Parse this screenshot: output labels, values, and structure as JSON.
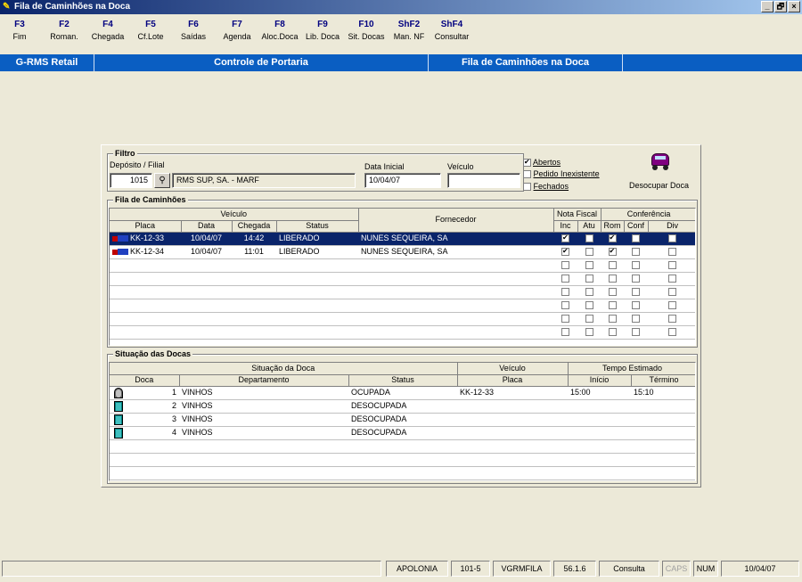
{
  "window": {
    "title": "Fila de Caminhões na Doca",
    "buttons": [
      "_",
      "🗗",
      "×"
    ]
  },
  "fkeys": [
    {
      "key": "F3",
      "label": "Fim"
    },
    {
      "key": "F2",
      "label": "Roman."
    },
    {
      "key": "F4",
      "label": "Chegada"
    },
    {
      "key": "F5",
      "label": "Cf.Lote"
    },
    {
      "key": "F6",
      "label": "Saídas"
    },
    {
      "key": "F7",
      "label": "Agenda"
    },
    {
      "key": "F8",
      "label": "Aloc.Doca"
    },
    {
      "key": "F9",
      "label": "Lib. Doca"
    },
    {
      "key": "F10",
      "label": "Sit. Docas"
    },
    {
      "key": "ShF2",
      "label": "Man. NF"
    },
    {
      "key": "ShF4",
      "label": "Consultar"
    }
  ],
  "header": {
    "app": "G-RMS Retail",
    "module": "Controle de Portaria",
    "screen": "Fila de Caminhões na Doca"
  },
  "filtro": {
    "title": "Filtro",
    "deposito_label": "Depósito / Filial",
    "deposito_value": "1015",
    "deposito_nome": "RMS SUP, SA. - MARF",
    "data_label": "Data Inicial",
    "data_value": "10/04/07",
    "veiculo_label": "Veículo",
    "veiculo_value": "",
    "abertos_label": "Abertos",
    "abertos_checked": true,
    "pedido_label": "Pedido Inexistente",
    "pedido_checked": false,
    "fechados_label": "Fechados",
    "fechados_checked": false,
    "desocupar_label": "Desocupar Doca"
  },
  "fila": {
    "title": "Fila de Caminhões",
    "group_veiculo": "Veículo",
    "group_nf": "Nota Fiscal",
    "group_conf": "Conferência",
    "col_placa": "Placa",
    "col_data": "Data",
    "col_chegada": "Chegada",
    "col_status": "Status",
    "col_fornecedor": "Fornecedor",
    "col_inc": "Inc",
    "col_atu": "Atu",
    "col_rom": "Rom",
    "col_conf": "Conf",
    "col_div": "Div",
    "rows": [
      {
        "placa": "KK-12-33",
        "data": "10/04/07",
        "chegada": "14:42",
        "status": "LIBERADO",
        "fornecedor": "NUNES SEQUEIRA, SA",
        "inc": true,
        "atu": false,
        "rom": true,
        "conf": false,
        "div": false,
        "selected": true
      },
      {
        "placa": "KK-12-34",
        "data": "10/04/07",
        "chegada": "11:01",
        "status": "LIBERADO",
        "fornecedor": "NUNES SEQUEIRA, SA",
        "inc": true,
        "atu": false,
        "rom": true,
        "conf": false,
        "div": false,
        "selected": false
      }
    ],
    "empty_rows": 6
  },
  "docas": {
    "title": "Situação das Docas",
    "group_situacao": "Situação da Doca",
    "group_veiculo": "Veículo",
    "group_tempo": "Tempo Estimado",
    "col_doca": "Doca",
    "col_depto": "Departamento",
    "col_status": "Status",
    "col_placa": "Placa",
    "col_inicio": "Início",
    "col_termino": "Término",
    "rows": [
      {
        "num": "1",
        "depto": "VINHOS",
        "status": "OCUPADA",
        "placa": "KK-12-33",
        "inicio": "15:00",
        "termino": "15:10",
        "busy": true
      },
      {
        "num": "2",
        "depto": "VINHOS",
        "status": "DESOCUPADA",
        "placa": "",
        "inicio": "",
        "termino": "",
        "busy": false
      },
      {
        "num": "3",
        "depto": "VINHOS",
        "status": "DESOCUPADA",
        "placa": "",
        "inicio": "",
        "termino": "",
        "busy": false
      },
      {
        "num": "4",
        "depto": "VINHOS",
        "status": "DESOCUPADA",
        "placa": "",
        "inicio": "",
        "termino": "",
        "busy": false
      }
    ],
    "empty_rows": 3
  },
  "statusbar": {
    "user": "APOLONIA",
    "code": "101-5",
    "program": "VGRMFILA",
    "version": "56.1.6",
    "mode": "Consulta",
    "caps": "CAPS",
    "num": "NUM",
    "date": "10/04/07"
  }
}
